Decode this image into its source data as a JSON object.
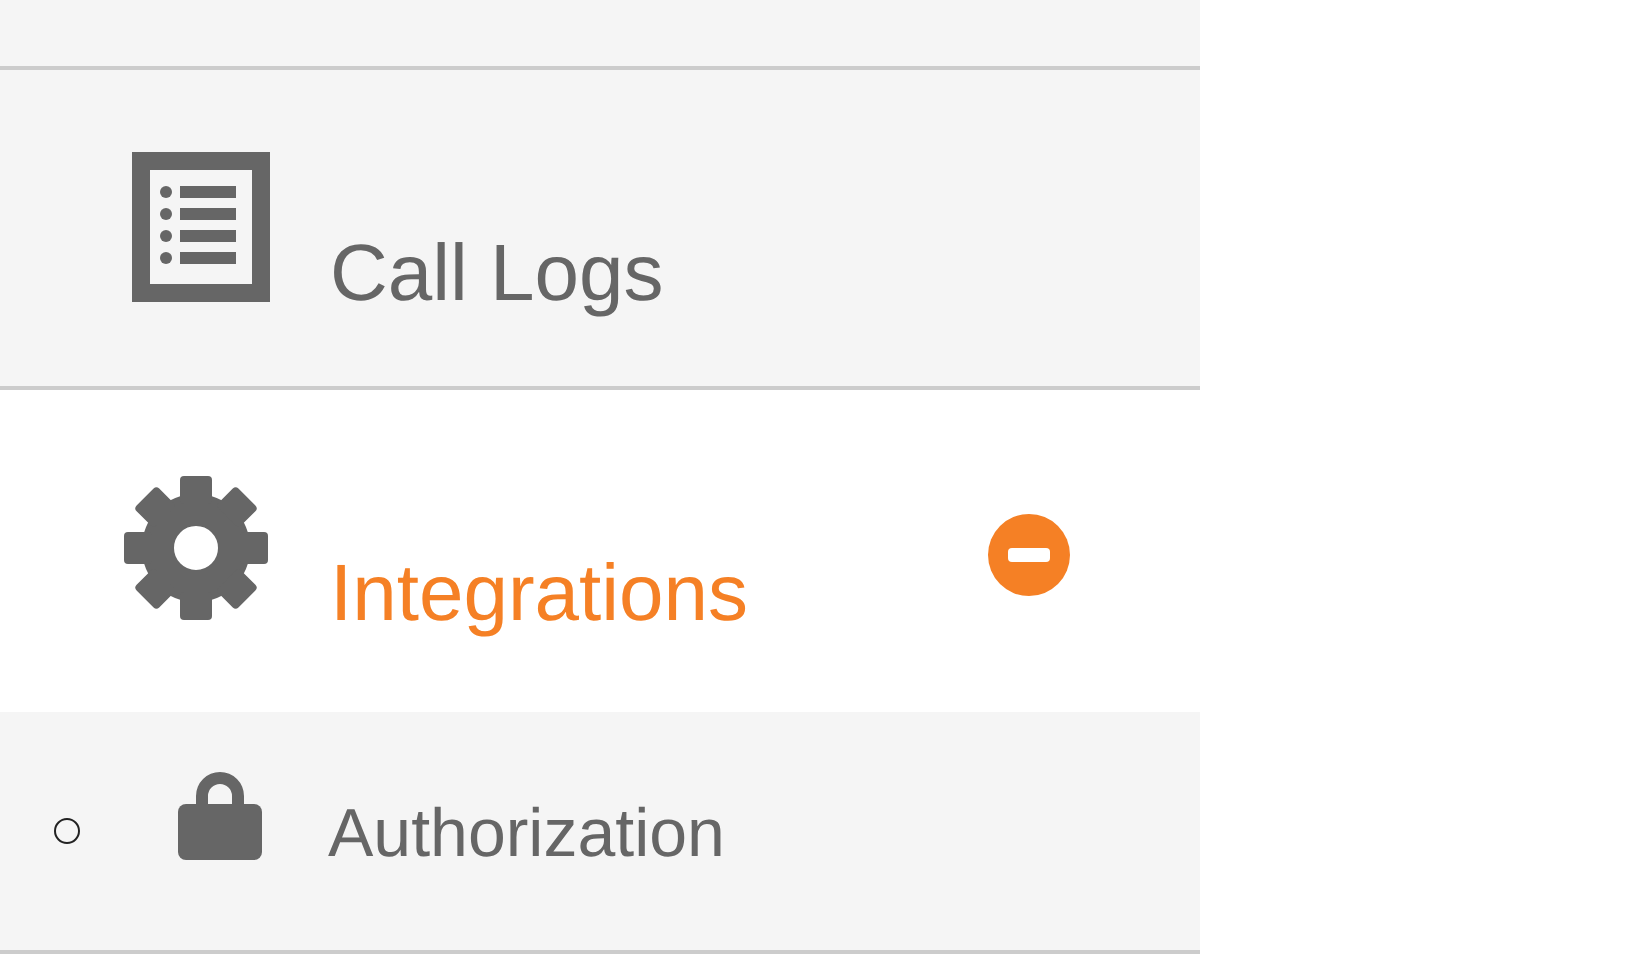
{
  "menu": {
    "items": [
      {
        "label": "Call Logs",
        "kind": "list",
        "selected": false
      },
      {
        "label": "Integrations",
        "kind": "gear",
        "selected": true,
        "expanded": true,
        "children": [
          {
            "label": "Authorization",
            "kind": "lock"
          }
        ]
      }
    ]
  }
}
